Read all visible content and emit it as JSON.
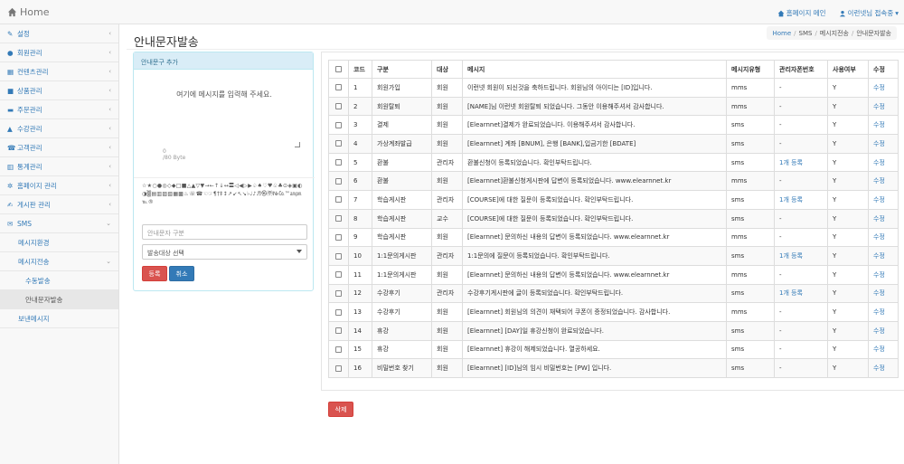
{
  "topbar": {
    "brand": "Home",
    "homepage_link": "홈페이지 메인",
    "user_menu": "이런넷님 접속중"
  },
  "sidebar": {
    "items": [
      {
        "label": "설정",
        "icon": "wrench-icon"
      },
      {
        "label": "회원관리",
        "icon": "user-icon"
      },
      {
        "label": "컨텐츠관리",
        "icon": "film-icon"
      },
      {
        "label": "상품관리",
        "icon": "gift-icon"
      },
      {
        "label": "주문관리",
        "icon": "folder-icon"
      },
      {
        "label": "수강관리",
        "icon": "graduation-cap-icon"
      },
      {
        "label": "고객관리",
        "icon": "phone-icon"
      },
      {
        "label": "통계관리",
        "icon": "bar-chart-icon"
      },
      {
        "label": "홈페이지 관리",
        "icon": "cogs-icon"
      },
      {
        "label": "게시판 관리",
        "icon": "edit-icon"
      },
      {
        "label": "SMS",
        "icon": "envelope-icon"
      }
    ],
    "sub_items": [
      "메시지환경",
      "메시지전송",
      "수동발송",
      "안내문자발송",
      "보낸메시지"
    ]
  },
  "page": {
    "title": "안내문자발송",
    "breadcrumb": [
      "Home",
      "SMS",
      "메시지전송",
      "안내문자발송"
    ]
  },
  "form": {
    "panel_title": "안내문구 추가",
    "message_placeholder": "여기에 메시지를 입력해 주세요.",
    "byte_count": "0",
    "byte_limit": "/80 Byte",
    "symbols": "☆★○●◎◇◆□■△▲▽▼→←↑↓↔〓◁◀▷▶♤♠♡♥♧♣⊙◈▣◐◑▒▤▥▨▧▦▩♨☏☎☜☞¶†‡↕↗↙↖↘♭♩♪♬㉿㈜№㏇™㏂㏘℡®",
    "type_input_placeholder": "안내문자 구분",
    "target_select": "발송대상 선택",
    "register_button": "등록",
    "cancel_button": "취소"
  },
  "table": {
    "headers": [
      "코드",
      "구분",
      "대상",
      "메시지",
      "메시지유형",
      "관리자폰번호",
      "사용여부",
      "수정"
    ],
    "rows": [
      {
        "code": "1",
        "type": "회원가입",
        "target": "회원",
        "message": "이런넷 회원이 되신것을 축하드립니다. 회원님의 아이디는 [ID]입니다.",
        "msg_type": "mms",
        "admin_phone": "-",
        "use": "Y",
        "edit": "수정"
      },
      {
        "code": "2",
        "type": "회원탈퇴",
        "target": "회원",
        "message": "[NAME]님 이런넷 회원탈퇴 되었습니다. 그동안 이용해주셔서 감사합니다.",
        "msg_type": "mms",
        "admin_phone": "-",
        "use": "Y",
        "edit": "수정"
      },
      {
        "code": "3",
        "type": "결제",
        "target": "회원",
        "message": "[Elearnnet]결제가 완료되었습니다. 이용해주셔서 감사합니다.",
        "msg_type": "sms",
        "admin_phone": "-",
        "use": "Y",
        "edit": "수정"
      },
      {
        "code": "4",
        "type": "가상계좌발급",
        "target": "회원",
        "message": "[Elearnnet] 계좌 [BNUM], 은행 [BANK],입금기한 [BDATE]",
        "msg_type": "sms",
        "admin_phone": "-",
        "use": "Y",
        "edit": "수정"
      },
      {
        "code": "5",
        "type": "환불",
        "target": "관리자",
        "message": "환불신청이 등록되었습니다. 확인부탁드립니다.",
        "msg_type": "sms",
        "admin_phone": "1개 등록",
        "use": "Y",
        "edit": "수정"
      },
      {
        "code": "6",
        "type": "환불",
        "target": "회원",
        "message": "[Elearnnet]환불신청게시판에 답변이 등록되었습니다. www.elearnnet.kr",
        "msg_type": "mms",
        "admin_phone": "-",
        "use": "Y",
        "edit": "수정"
      },
      {
        "code": "7",
        "type": "학습게시판",
        "target": "관리자",
        "message": "[COURSE]에 대한 질문이 등록되었습니다. 확인부탁드립니다.",
        "msg_type": "sms",
        "admin_phone": "1개 등록",
        "use": "Y",
        "edit": "수정"
      },
      {
        "code": "8",
        "type": "학습게시판",
        "target": "교수",
        "message": "[COURSE]에 대한 질문이 등록되었습니다. 확인부탁드립니다.",
        "msg_type": "sms",
        "admin_phone": "-",
        "use": "Y",
        "edit": "수정"
      },
      {
        "code": "9",
        "type": "학습게시판",
        "target": "회원",
        "message": "[Elearnnet] 문의하신 내용의 답변이 등록되었습니다. www.elearnnet.kr",
        "msg_type": "mms",
        "admin_phone": "-",
        "use": "Y",
        "edit": "수정"
      },
      {
        "code": "10",
        "type": "1:1문의게시판",
        "target": "관리자",
        "message": "1:1문의에 질문이 등록되었습니다. 확인부탁드립니다.",
        "msg_type": "sms",
        "admin_phone": "1개 등록",
        "use": "Y",
        "edit": "수정"
      },
      {
        "code": "11",
        "type": "1:1문의게시판",
        "target": "회원",
        "message": "[Elearnnet] 문의하신 내용의 답변이 등록되었습니다. www.elearnnet.kr",
        "msg_type": "mms",
        "admin_phone": "-",
        "use": "Y",
        "edit": "수정"
      },
      {
        "code": "12",
        "type": "수강후기",
        "target": "관리자",
        "message": "수강후기게시판에 글이 등록되었습니다. 확인부탁드립니다.",
        "msg_type": "sms",
        "admin_phone": "1개 등록",
        "use": "Y",
        "edit": "수정"
      },
      {
        "code": "13",
        "type": "수강후기",
        "target": "회원",
        "message": "[Elearnnet] 회원님의 의견이 채택되어 쿠폰이 증정되었습니다. 감사합니다.",
        "msg_type": "mms",
        "admin_phone": "-",
        "use": "Y",
        "edit": "수정"
      },
      {
        "code": "14",
        "type": "휴강",
        "target": "회원",
        "message": "[Elearnnet] [DAY]일 휴강신청이 완료되었습니다.",
        "msg_type": "sms",
        "admin_phone": "-",
        "use": "Y",
        "edit": "수정"
      },
      {
        "code": "15",
        "type": "휴강",
        "target": "회원",
        "message": "[Elearnnet] 휴강이 해제되었습니다. 열공하세요.",
        "msg_type": "sms",
        "admin_phone": "-",
        "use": "Y",
        "edit": "수정"
      },
      {
        "code": "16",
        "type": "비밀번호 찾기",
        "target": "회원",
        "message": "[Elearnnet] [ID]님의 임시 비밀번호는 [PW] 입니다.",
        "msg_type": "sms",
        "admin_phone": "-",
        "use": "Y",
        "edit": "수정"
      }
    ],
    "delete_button": "삭제"
  },
  "colors": {
    "accent": "#337ab7",
    "danger": "#d9534f",
    "panel_head_bg": "#d9edf7"
  }
}
